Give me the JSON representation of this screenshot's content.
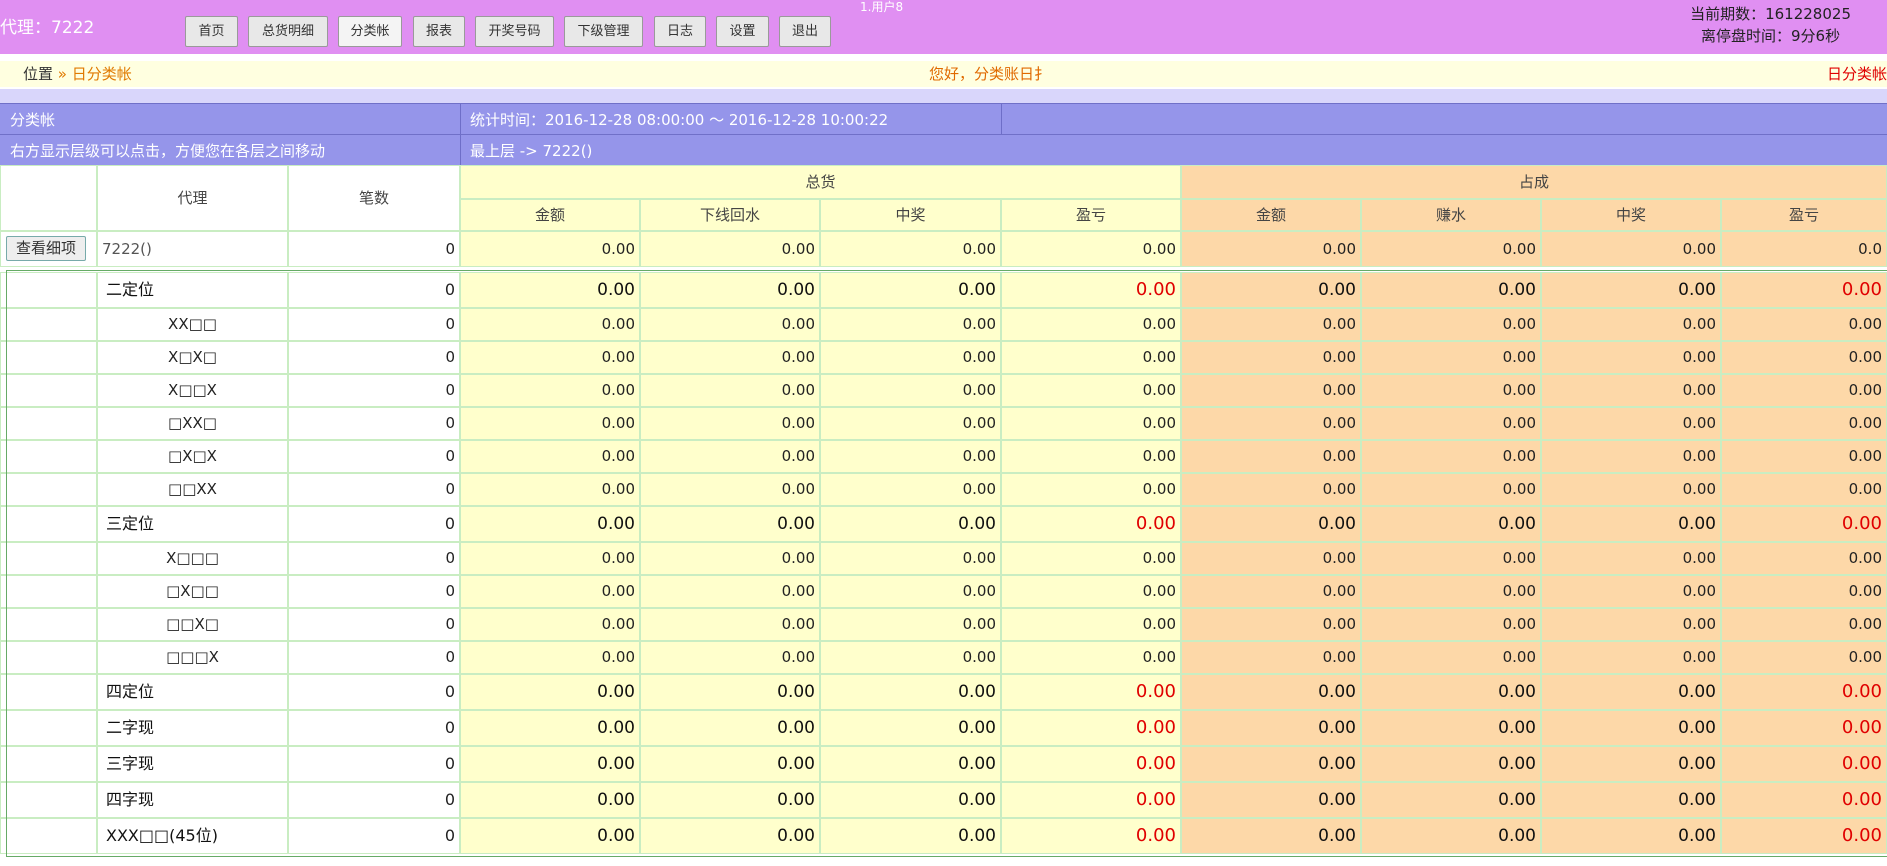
{
  "header": {
    "agent": "代理：7222",
    "user_tag": "1.用户8",
    "nav": [
      "首页",
      "总货明细",
      "分类帐",
      "报表",
      "开奖号码",
      "下级管理",
      "日志",
      "设置",
      "退出"
    ],
    "period_label": "当前期数：161228025",
    "close_label": "离停盘时间：9分6秒"
  },
  "breadcrumb": {
    "position": "位置",
    "current": " » 日分类帐",
    "marquee": "您好，分类账日扌",
    "right": "日分类帐"
  },
  "info": {
    "title": "分类帐",
    "stat_time": "统计时间：2016-12-28 08:00:00 ～ 2016-12-28 10:00:22",
    "hint": "右方显示层级可以点击，方便您在各层之间移动",
    "level": "最上层 -> 7222()"
  },
  "table": {
    "h_agent": "代理",
    "h_count": "笔数",
    "h_total": "总货",
    "h_share": "占成",
    "sub_total": [
      "金额",
      "下线回水",
      "中奖",
      "盈亏"
    ],
    "sub_share": [
      "金额",
      "赚水",
      "中奖",
      "盈亏"
    ],
    "detail_button": "查看细项",
    "summary": {
      "agent": "7222()",
      "count": "0",
      "vals": [
        "0.00",
        "0.00",
        "0.00",
        "0.00",
        "0.00",
        "0.00",
        "0.00",
        "0.0"
      ]
    },
    "rows": [
      {
        "name": "二定位",
        "bold": true,
        "count": "0",
        "vals": [
          "0.00",
          "0.00",
          "0.00",
          "0.00",
          "0.00",
          "0.00",
          "0.00",
          "0.00"
        ]
      },
      {
        "name": "XX□□",
        "bold": false,
        "count": "0",
        "vals": [
          "0.00",
          "0.00",
          "0.00",
          "0.00",
          "0.00",
          "0.00",
          "0.00",
          "0.00"
        ]
      },
      {
        "name": "X□X□",
        "bold": false,
        "count": "0",
        "vals": [
          "0.00",
          "0.00",
          "0.00",
          "0.00",
          "0.00",
          "0.00",
          "0.00",
          "0.00"
        ]
      },
      {
        "name": "X□□X",
        "bold": false,
        "count": "0",
        "vals": [
          "0.00",
          "0.00",
          "0.00",
          "0.00",
          "0.00",
          "0.00",
          "0.00",
          "0.00"
        ]
      },
      {
        "name": "□XX□",
        "bold": false,
        "count": "0",
        "vals": [
          "0.00",
          "0.00",
          "0.00",
          "0.00",
          "0.00",
          "0.00",
          "0.00",
          "0.00"
        ]
      },
      {
        "name": "□X□X",
        "bold": false,
        "count": "0",
        "vals": [
          "0.00",
          "0.00",
          "0.00",
          "0.00",
          "0.00",
          "0.00",
          "0.00",
          "0.00"
        ]
      },
      {
        "name": "□□XX",
        "bold": false,
        "count": "0",
        "vals": [
          "0.00",
          "0.00",
          "0.00",
          "0.00",
          "0.00",
          "0.00",
          "0.00",
          "0.00"
        ]
      },
      {
        "name": "三定位",
        "bold": true,
        "count": "0",
        "vals": [
          "0.00",
          "0.00",
          "0.00",
          "0.00",
          "0.00",
          "0.00",
          "0.00",
          "0.00"
        ]
      },
      {
        "name": "X□□□",
        "bold": false,
        "count": "0",
        "vals": [
          "0.00",
          "0.00",
          "0.00",
          "0.00",
          "0.00",
          "0.00",
          "0.00",
          "0.00"
        ]
      },
      {
        "name": "□X□□",
        "bold": false,
        "count": "0",
        "vals": [
          "0.00",
          "0.00",
          "0.00",
          "0.00",
          "0.00",
          "0.00",
          "0.00",
          "0.00"
        ]
      },
      {
        "name": "□□X□",
        "bold": false,
        "count": "0",
        "vals": [
          "0.00",
          "0.00",
          "0.00",
          "0.00",
          "0.00",
          "0.00",
          "0.00",
          "0.00"
        ]
      },
      {
        "name": "□□□X",
        "bold": false,
        "count": "0",
        "vals": [
          "0.00",
          "0.00",
          "0.00",
          "0.00",
          "0.00",
          "0.00",
          "0.00",
          "0.00"
        ]
      },
      {
        "name": "四定位",
        "bold": true,
        "count": "0",
        "vals": [
          "0.00",
          "0.00",
          "0.00",
          "0.00",
          "0.00",
          "0.00",
          "0.00",
          "0.00"
        ]
      },
      {
        "name": "二字现",
        "bold": true,
        "count": "0",
        "vals": [
          "0.00",
          "0.00",
          "0.00",
          "0.00",
          "0.00",
          "0.00",
          "0.00",
          "0.00"
        ]
      },
      {
        "name": "三字现",
        "bold": true,
        "count": "0",
        "vals": [
          "0.00",
          "0.00",
          "0.00",
          "0.00",
          "0.00",
          "0.00",
          "0.00",
          "0.00"
        ]
      },
      {
        "name": "四字现",
        "bold": true,
        "count": "0",
        "vals": [
          "0.00",
          "0.00",
          "0.00",
          "0.00",
          "0.00",
          "0.00",
          "0.00",
          "0.00"
        ]
      },
      {
        "name": "XXX□□(45位)",
        "bold": true,
        "count": "0",
        "vals": [
          "0.00",
          "0.00",
          "0.00",
          "0.00",
          "0.00",
          "0.00",
          "0.00",
          "0.00"
        ]
      }
    ]
  }
}
